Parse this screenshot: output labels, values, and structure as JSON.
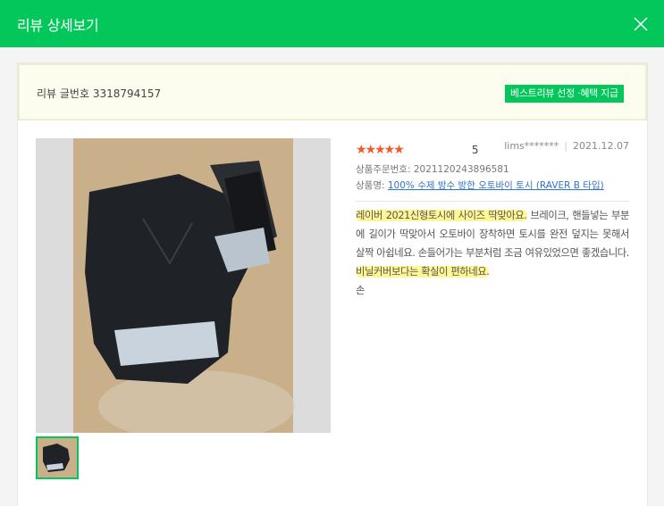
{
  "header": {
    "title": "리뷰 상세보기"
  },
  "notice": {
    "review_number": "리뷰 글번호 3318794157",
    "badge": "베스트리뷰 선정 ·혜택 지급"
  },
  "review": {
    "rating_stars": "★★★★★",
    "rating": "5",
    "author": "lims*******",
    "date": "2021.12.07",
    "order_number": "상품주문번호: 2021120243896581",
    "product_label": "상품명:",
    "product_name": "100% 수제 방수 방한 오토바이 토시 (RAVER B 타입)",
    "text_part1": "레이버 2021신형토시에 사이즈 딱맞아요.",
    "text_part2": " 브레이크, 핸들넣는 부분에 길이가 딱맞아서 오토바이 장착하면 토시를 완전 덮지는 못해서 살짝 아쉽네요. 손들어가는 부분처럼 조금 여유있었으면 좋겠습니다. ",
    "text_part3": "비닐커버보다는 확실이 편하네요.",
    "text_part4": "\n손"
  },
  "colors": {
    "brand": "#03c75a",
    "star": "#f15a29",
    "link": "#2e74c9"
  },
  "icons": {
    "close": "close-icon",
    "star": "star-icon"
  }
}
